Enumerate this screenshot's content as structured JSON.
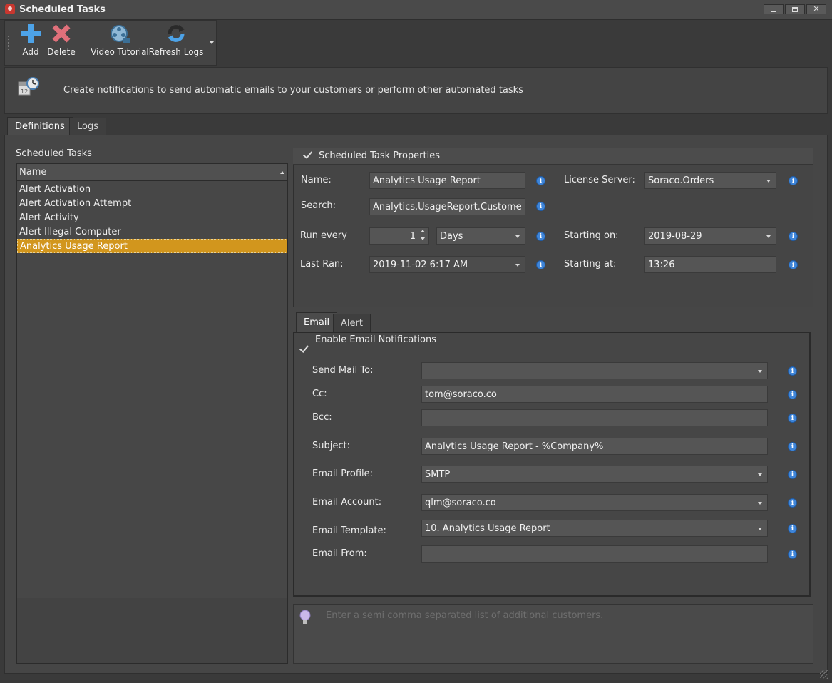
{
  "window": {
    "title": "Scheduled Tasks"
  },
  "toolbar": {
    "add_label": "Add",
    "delete_label": "Delete",
    "video_label": "Video Tutorial",
    "refresh_label": "Refresh Logs"
  },
  "banner": {
    "text": "Create notifications to send automatic emails to your customers or perform other automated tasks"
  },
  "tabs": {
    "definitions": "Definitions",
    "logs": "Logs"
  },
  "task_list": {
    "title": "Scheduled Tasks",
    "column": "Name",
    "items": [
      "Alert Activation",
      "Alert Activation Attempt",
      "Alert Activity",
      "Alert Illegal Computer",
      "Analytics Usage Report"
    ],
    "selected": "Analytics Usage Report"
  },
  "properties": {
    "header": "Scheduled Task Properties",
    "name_label": "Name:",
    "name_value": "Analytics Usage Report",
    "license_label": "License Server:",
    "license_value": "Soraco.Orders",
    "search_label": "Search:",
    "search_value": "Analytics.UsageReport.Custome",
    "run_label": "Run every",
    "run_value": "1",
    "run_unit": "Days",
    "starting_on_label": "Starting on:",
    "starting_on_value": "2019-08-29",
    "last_ran_label": "Last Ran:",
    "last_ran_value": "2019-11-02 6:17 AM",
    "starting_at_label": "Starting at:",
    "starting_at_value": "13:26"
  },
  "subtabs": {
    "email": "Email",
    "alert": "Alert"
  },
  "email": {
    "enable_label": "Enable Email Notifications",
    "send_to_label": "Send Mail To:",
    "send_to_value": "",
    "cc_label": "Cc:",
    "cc_value": "tom@soraco.co",
    "bcc_label": "Bcc:",
    "bcc_value": "",
    "subject_label": "Subject:",
    "subject_value": "Analytics Usage Report - %Company%",
    "profile_label": "Email Profile:",
    "profile_value": "SMTP",
    "account_label": "Email Account:",
    "account_value": "qlm@soraco.co",
    "template_label": "Email Template:",
    "template_value": "10. Analytics Usage Report",
    "from_label": "Email From:",
    "from_value": ""
  },
  "tip": {
    "text": "Enter a semi comma separated list of additional customers."
  },
  "colors": {
    "selection": "#d2961d",
    "info_icon": "#3f85d8",
    "add_icon": "#4da3e8",
    "delete_icon": "#e0707a"
  }
}
